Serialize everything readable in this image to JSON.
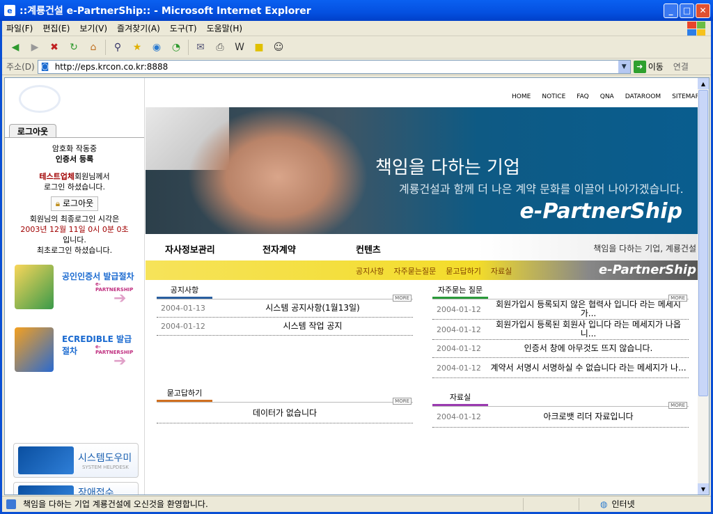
{
  "window": {
    "title": "::계룡건설 e-PartnerShip:: - Microsoft Internet Explorer"
  },
  "menubar": [
    "파일(F)",
    "편집(E)",
    "보기(V)",
    "즐겨찾기(A)",
    "도구(T)",
    "도움말(H)"
  ],
  "address": {
    "label": "주소(D)",
    "url": "http://eps.krcon.co.kr:8888",
    "go_label": "이동",
    "links_label": "연결"
  },
  "left": {
    "logout_tab": "로그아웃",
    "status1": "암호화 작동중",
    "status2": "인증서 등록",
    "company": "테스트업체",
    "greeting": "회원님께서",
    "greeting2": "로그인 하셨습니다.",
    "logout_button": "로그아웃",
    "last_login_label": "회원님의 최종로그인 시각은",
    "last_login_time": "2003년 12월 11일 0시 0분 0초",
    "last_login_suffix": "입니다.",
    "first_login": "최초로그인 하셨습니다.",
    "banner1_title": "공인인증서 발급절차",
    "banner1_sub": "e-PARTNERSHIP",
    "banner2_title": "ECREDIBLE 발급절차",
    "banner2_sub": "e-PARTNERSHIP",
    "help_title": "시스템도우미",
    "help_sub": "SYSTEM HELPDESK",
    "support_title": "장애접수"
  },
  "topnav": [
    "HOME",
    "NOTICE",
    "FAQ",
    "QNA",
    "DATAROOM",
    "SITEMAP"
  ],
  "hero": {
    "headline": "책임을 다하는 기업",
    "subline": "계룡건설과 함께 더 나은 계약 문화를 이끌어 나아가겠습니다.",
    "logo": "e-PartnerShip"
  },
  "menu1": {
    "items": [
      "자사정보관리",
      "전자계약",
      "컨텐츠"
    ],
    "slogan": "책임을 다하는 기업, 계룡건설"
  },
  "menu2": {
    "items": [
      "공지사항",
      "자주묻는질문",
      "묻고답하기",
      "자료실"
    ],
    "logo": "e-PartnerShip"
  },
  "more_label": "MORE",
  "notice": {
    "title": "공지사항",
    "rows": [
      {
        "date": "2004-01-13",
        "subject": "시스템 공지사항(1월13일)"
      },
      {
        "date": "2004-01-12",
        "subject": "시스템 작업 공지"
      }
    ]
  },
  "qna": {
    "title": "묻고답하기",
    "empty": "데이터가 없습니다"
  },
  "faq": {
    "title": "자주묻는 질문",
    "rows": [
      {
        "date": "2004-01-12",
        "subject": "회원가입시 등록되지 않은 협력사 입니다 라는 메세지가..."
      },
      {
        "date": "2004-01-12",
        "subject": "회원가입시 등록된 회원사 입니다 라는 메세지가 나옵니..."
      },
      {
        "date": "2004-01-12",
        "subject": "인증서 창에 아무것도 뜨지 않습니다."
      },
      {
        "date": "2004-01-12",
        "subject": "계약서 서명시 서명하실 수 없습니다 라는 메세지가 나..."
      }
    ]
  },
  "data": {
    "title": "자료실",
    "rows": [
      {
        "date": "2004-01-12",
        "subject": "아크로뱃 리더 자료입니다"
      }
    ]
  },
  "status": {
    "text": "책임을 다하는 기업 계룡건설에 오신것을 환영합니다.",
    "zone": "인터넷"
  }
}
